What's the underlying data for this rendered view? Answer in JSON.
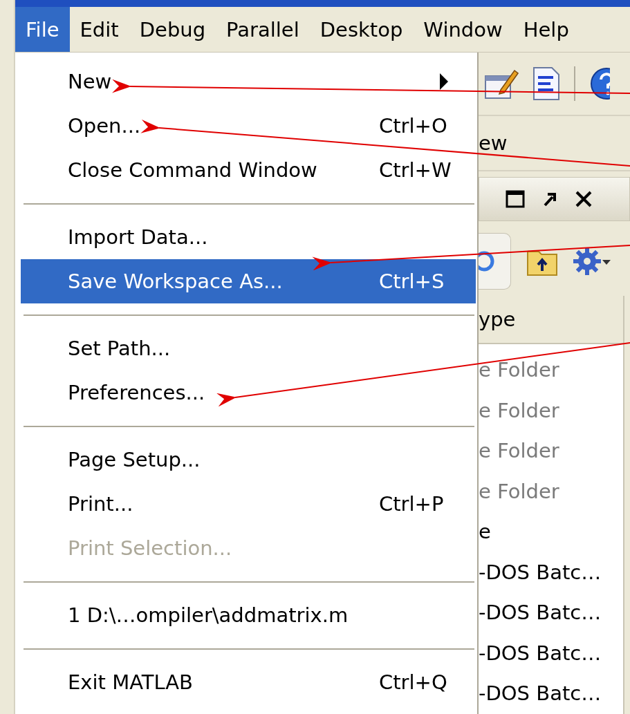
{
  "menubar": [
    {
      "label": "File",
      "selected": true
    },
    {
      "label": "Edit",
      "selected": false
    },
    {
      "label": "Debug",
      "selected": false
    },
    {
      "label": "Parallel",
      "selected": false
    },
    {
      "label": "Desktop",
      "selected": false
    },
    {
      "label": "Window",
      "selected": false
    },
    {
      "label": "Help",
      "selected": false
    }
  ],
  "file_menu": [
    {
      "kind": "item",
      "label": "New",
      "submenu": true,
      "selected": false,
      "disabled": false
    },
    {
      "kind": "item",
      "label": "Open...",
      "shortcut": "Ctrl+O",
      "selected": false,
      "disabled": false
    },
    {
      "kind": "item",
      "label": "Close Command Window",
      "shortcut": "Ctrl+W",
      "selected": false,
      "disabled": false
    },
    {
      "kind": "separator"
    },
    {
      "kind": "item",
      "label": "Import Data...",
      "selected": false,
      "disabled": false
    },
    {
      "kind": "item",
      "label": "Save Workspace As...",
      "shortcut": "Ctrl+S",
      "selected": true,
      "disabled": false
    },
    {
      "kind": "separator"
    },
    {
      "kind": "item",
      "label": "Set Path...",
      "selected": false,
      "disabled": false
    },
    {
      "kind": "item",
      "label": "Preferences...",
      "selected": false,
      "disabled": false
    },
    {
      "kind": "separator"
    },
    {
      "kind": "item",
      "label": "Page Setup...",
      "selected": false,
      "disabled": false
    },
    {
      "kind": "item",
      "label": "Print...",
      "shortcut": "Ctrl+P",
      "selected": false,
      "disabled": false
    },
    {
      "kind": "item",
      "label": "Print Selection...",
      "selected": false,
      "disabled": true
    },
    {
      "kind": "separator"
    },
    {
      "kind": "item",
      "label": "1 D:\\…ompiler\\addmatrix.m",
      "selected": false,
      "disabled": false
    },
    {
      "kind": "separator"
    },
    {
      "kind": "item",
      "label": "Exit MATLAB",
      "shortcut": "Ctrl+Q",
      "selected": false,
      "disabled": false
    }
  ],
  "background_window": {
    "panel_label": "ew",
    "column_header": "ype",
    "rows": [
      {
        "text": "e Folder",
        "dimmed": true
      },
      {
        "text": "e Folder",
        "dimmed": true
      },
      {
        "text": "e Folder",
        "dimmed": true
      },
      {
        "text": "e Folder",
        "dimmed": true
      },
      {
        "text": "e",
        "dimmed": false
      },
      {
        "text": "-DOS Batc…",
        "dimmed": false
      },
      {
        "text": "-DOS Batc…",
        "dimmed": false
      },
      {
        "text": "-DOS Batc…",
        "dimmed": false
      },
      {
        "text": "-DOS Batc…",
        "dimmed": false
      }
    ]
  }
}
